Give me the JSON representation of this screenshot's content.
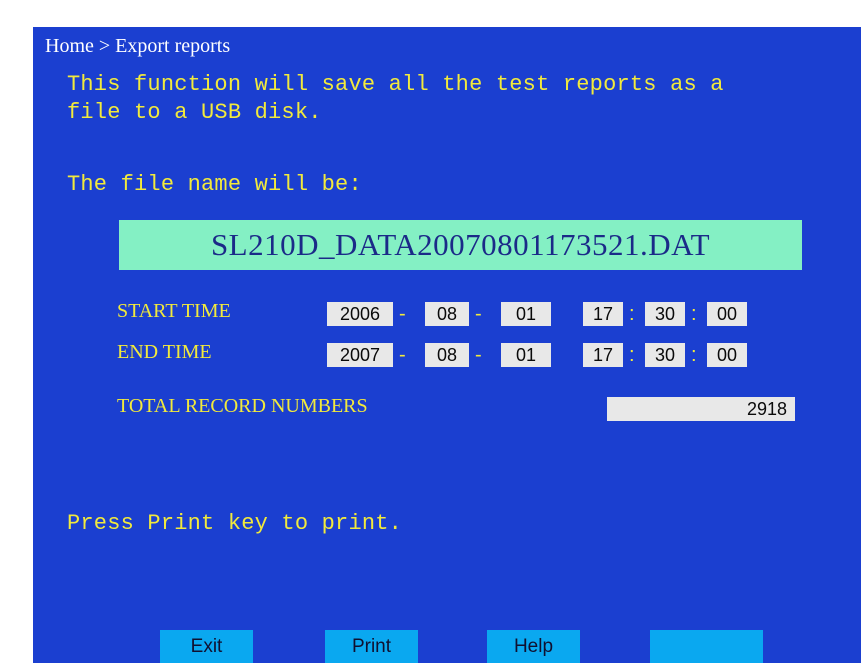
{
  "breadcrumb": "Home > Export reports",
  "description_line1": "This function will save all the test reports as a",
  "description_line2": "file to a USB disk.",
  "filename_label": "The file name will be:",
  "filename": "SL210D_DATA20070801173521.DAT",
  "start_time": {
    "label": "START TIME",
    "year": "2006",
    "month": "08",
    "day": "01",
    "hour": "17",
    "minute": "30",
    "second": "00"
  },
  "end_time": {
    "label": "END TIME",
    "year": "2007",
    "month": "08",
    "day": "01",
    "hour": "17",
    "minute": "30",
    "second": "00"
  },
  "separators": {
    "date": "-",
    "time": ":"
  },
  "total": {
    "label": "TOTAL RECORD NUMBERS",
    "value": "2918"
  },
  "print_hint": "Press Print key to print.",
  "buttons": {
    "exit": "Exit",
    "print": "Print",
    "help": "Help",
    "blank": ""
  },
  "colors": {
    "background": "#1b3fd0",
    "text": "#f2ea3c",
    "filename_box": "#84f0c4",
    "button": "#0aa8f0"
  }
}
